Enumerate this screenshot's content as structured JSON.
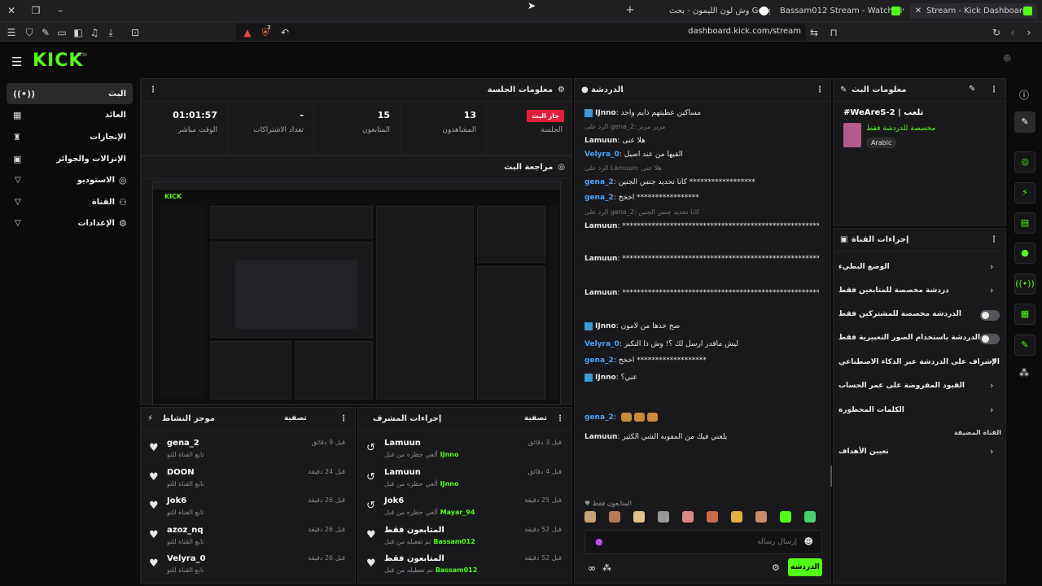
{
  "browser": {
    "tabs": [
      {
        "label": "Stream - Kick Dashboard",
        "active": true
      },
      {
        "label": "Bassam012 Stream - Watch Live on K",
        "active": false
      },
      {
        "label": "وش لون الليمون - بحث Google",
        "active": false
      }
    ],
    "url": "dashboard.kick.com/stream",
    "shield_count": "3"
  },
  "brand": {
    "logo": "KICK",
    "beta": "BETA",
    "accent": "#53fc18"
  },
  "nav": [
    {
      "label": "البث",
      "icon": "broadcast-icon",
      "active": true
    },
    {
      "label": "العائد",
      "icon": "grid-icon"
    },
    {
      "label": "الإنجازات",
      "icon": "trophy-icon"
    },
    {
      "label": "الإنزالات والجوائز",
      "icon": "gift-icon"
    },
    {
      "label": "الاستوديو",
      "icon": "target-icon",
      "chevron": true
    },
    {
      "label": "القناة",
      "icon": "users-icon",
      "chevron": true
    },
    {
      "label": "الإعدادات",
      "icon": "gear-icon",
      "chevron": true
    }
  ],
  "session": {
    "title": "معلومات الجلسة",
    "badge": "جار البث",
    "badge_label": "الجلسة",
    "stats": [
      {
        "value": "01:01:57",
        "label": "الوقت مباشر"
      },
      {
        "value": "-",
        "label": "تعداد الاشتراكات"
      },
      {
        "value": "15",
        "label": "المتابعون"
      },
      {
        "value": "13",
        "label": "المشاهدون"
      }
    ]
  },
  "preview": {
    "title": "مراجعة البث"
  },
  "activity": {
    "title": "موجز النشاط",
    "filter": "تصفية",
    "items": [
      {
        "name": "gena_2",
        "sub": "تابع القناة للتو",
        "time": "قبل 9 دقائق"
      },
      {
        "name": "DOON",
        "sub": "تابع القناة للتو",
        "time": "قبل 24 دقيقة"
      },
      {
        "name": "Jok6",
        "sub": "تابع القناة للتو",
        "time": "قبل 26 دقيقة"
      },
      {
        "name": "azoz_nq",
        "sub": "تابع القناة للتو",
        "time": "قبل 26 دقيقة"
      },
      {
        "name": "Velyra_0",
        "sub": "تابع القناة للتو",
        "time": "قبل 26 دقيقة"
      }
    ]
  },
  "modactions": {
    "title": "إجراءات المشرف",
    "filter": "تصفية",
    "items": [
      {
        "name": "Lamuun",
        "sub": "ألغي حظره من قبل",
        "by": "IJnno",
        "time": "قبل 3 دقائق"
      },
      {
        "name": "Lamuun",
        "sub": "ألغي حظره من قبل",
        "by": "IJnno",
        "time": "قبل 4 دقائق"
      },
      {
        "name": "Jok6",
        "sub": "ألغي حظره من قبل",
        "by": "Mayar_94",
        "time": "قبل 25 دقيقة"
      },
      {
        "name": "المتابعون فقط",
        "sub": "تم تفعيله من قبل",
        "by": "Bassam012",
        "time": "قبل 52 دقيقة"
      },
      {
        "name": "المتابعون فقط",
        "sub": "تم تعطيله من قبل",
        "by": "Bassam012",
        "time": "قبل 52 دقيقة"
      }
    ]
  },
  "chat": {
    "title": "الدردشة",
    "messages": [
      {
        "user": "IJnno",
        "color": "#e8e8e8",
        "text": "مساكين عطيتهم ذايم واحد"
      },
      {
        "reply": "الرد على gena_2: مرير مرير"
      },
      {
        "user": "Lamuun",
        "color": "#e8e8e8",
        "text": "هلا عنى"
      },
      {
        "user": "Velyra_0",
        "color": "#4aa3ff",
        "text": "القيها من عند اصيل"
      },
      {
        "reply": "الرد على Lamuun: هلا عنى"
      },
      {
        "user": "gena_2",
        "color": "#4aa3ff",
        "text": "كانا تحديد جنس الجنين ******************"
      },
      {
        "user": "gena_2",
        "color": "#4aa3ff",
        "text": "اخخخ *****************"
      },
      {
        "reply": "الرد على gena_2: كانا تحديد جنس الجنين"
      },
      {
        "user": "Lamuun",
        "color": "#e8e8e8",
        "text": "*******************************************************"
      },
      {
        "user": "Lamuun",
        "color": "#e8e8e8",
        "text": "*******************************************************"
      },
      {
        "user": "Lamuun",
        "color": "#e8e8e8",
        "text": "*******************************************************"
      },
      {
        "user": "IJnno",
        "color": "#e8e8e8",
        "text": "صح خذها من لامون"
      },
      {
        "user": "Velyra_0",
        "color": "#4aa3ff",
        "text": "ليش ماقدر ارسل لك ؟! وش ذا التكبر"
      },
      {
        "user": "gena_2",
        "color": "#4aa3ff",
        "text": "اخخخ *******************"
      },
      {
        "user": "IJnno",
        "color": "#e8e8e8",
        "text": "عني؟"
      },
      {
        "user": "gena_2",
        "color": "#4aa3ff",
        "text": ""
      },
      {
        "user": "Lamuun",
        "color": "#e8e8e8",
        "text": "يلعني فيك من المفوبه الشي الكثير"
      }
    ],
    "followers_only": "المتابعون فقط",
    "placeholder": "إرسال رسالة",
    "send": "الدردشة"
  },
  "streaminfo": {
    "title": "معلومات البث",
    "stream_title": "#WeAreS-2 | تلعب",
    "category": "مخصصة للدردشة فقط",
    "language": "Arabic"
  },
  "channelactions": {
    "title": "إجراءات القناة",
    "rows": [
      {
        "label": "الوضع البطيء",
        "kind": "chevron"
      },
      {
        "label": "دردشة مخصصة للمتابعين فقط",
        "kind": "chevron"
      },
      {
        "label": "الدردشة مخصصة للمشتركين فقط",
        "kind": "toggle"
      },
      {
        "label": "الدردشة باستخدام الصور التعبيرية فقط",
        "kind": "toggle"
      },
      {
        "label": "الإشراف على الدردشة عبر الذكاء الاصطناعي",
        "kind": "link"
      },
      {
        "label": "القيود المفروضة على عمر الحساب",
        "kind": "chevron"
      },
      {
        "label": "الكلمات المحظورة",
        "kind": "chevron"
      },
      {
        "label": "القناة المضيفة",
        "kind": "heading"
      },
      {
        "label": "تعيين الأهداف",
        "kind": "chevron"
      }
    ]
  }
}
